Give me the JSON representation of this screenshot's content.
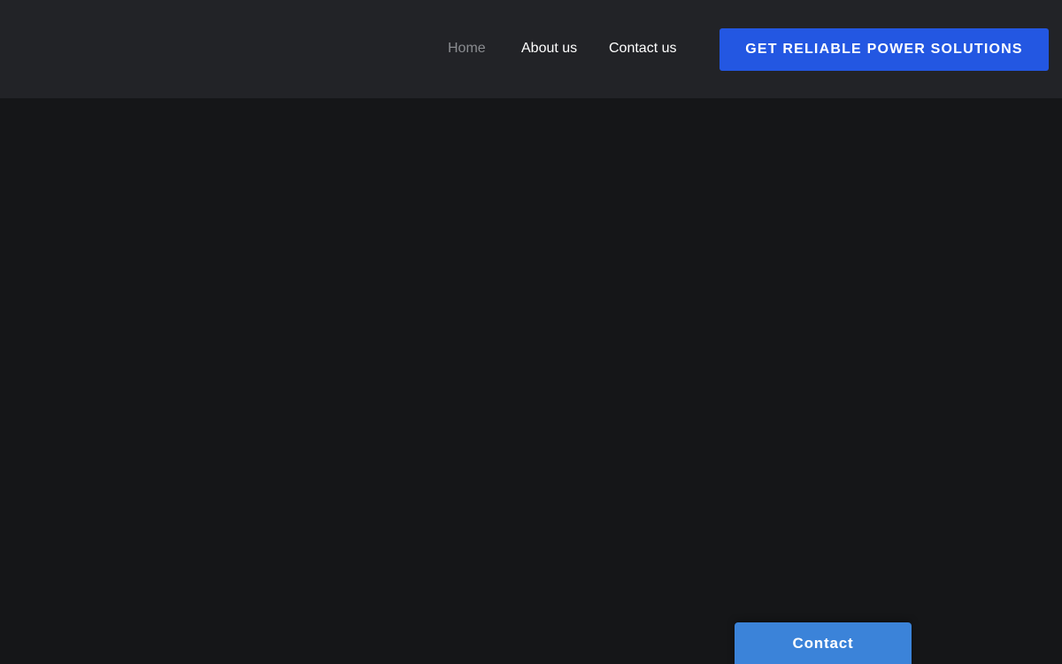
{
  "header": {
    "nav": [
      {
        "label": "Home",
        "active": true
      },
      {
        "label": "About us",
        "active": false
      },
      {
        "label": "Contact us",
        "active": false
      }
    ],
    "cta_label": "GET RELIABLE POWER SOLUTIONS"
  },
  "floating_contact": {
    "label": "Contact"
  },
  "colors": {
    "header_bg": "#222327",
    "page_bg": "#151618",
    "cta_bg": "#2357e2",
    "contact_tab_bg": "#3b83d9",
    "nav_active": "#8a8c90",
    "nav_text": "#ffffff"
  }
}
